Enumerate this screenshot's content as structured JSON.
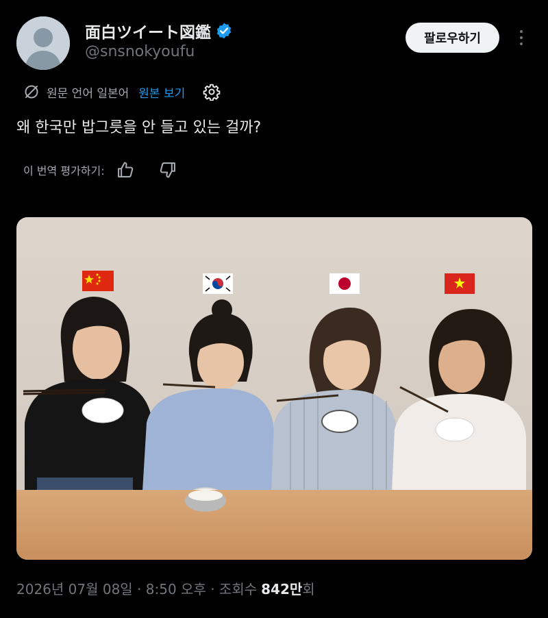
{
  "author": {
    "display_name": "面白ツイート図鑑",
    "handle": "@snsnokyoufu",
    "verified_icon": "verified-badge-icon",
    "verified_color": "#1d9bf0"
  },
  "actions": {
    "follow_label": "팔로우하기",
    "more_icon": "more-options-icon"
  },
  "translation": {
    "source_language": "원문 언어 일본어",
    "show_original": "원본 보기",
    "settings_icon": "gear-icon",
    "rate_label": "이 번역 평가하기:",
    "thumbs_up_icon": "thumbs-up-icon",
    "thumbs_down_icon": "thumbs-down-icon"
  },
  "tweet": {
    "text": "왜 한국만 밥그릇을 안 들고 있는 걸까?"
  },
  "media": {
    "flags": [
      "china-flag",
      "south-korea-flag",
      "japan-flag",
      "vietnam-flag"
    ]
  },
  "meta": {
    "timestamp": "2026년 07월 08일 · 8:50 오후 · 조회수",
    "views_count": "842",
    "views_unit": "만",
    "views_suffix": "회"
  },
  "colors": {
    "background": "#000000",
    "link": "#1d9bf0",
    "secondary_text": "#71767b",
    "primary_text": "#e7e9ea"
  }
}
